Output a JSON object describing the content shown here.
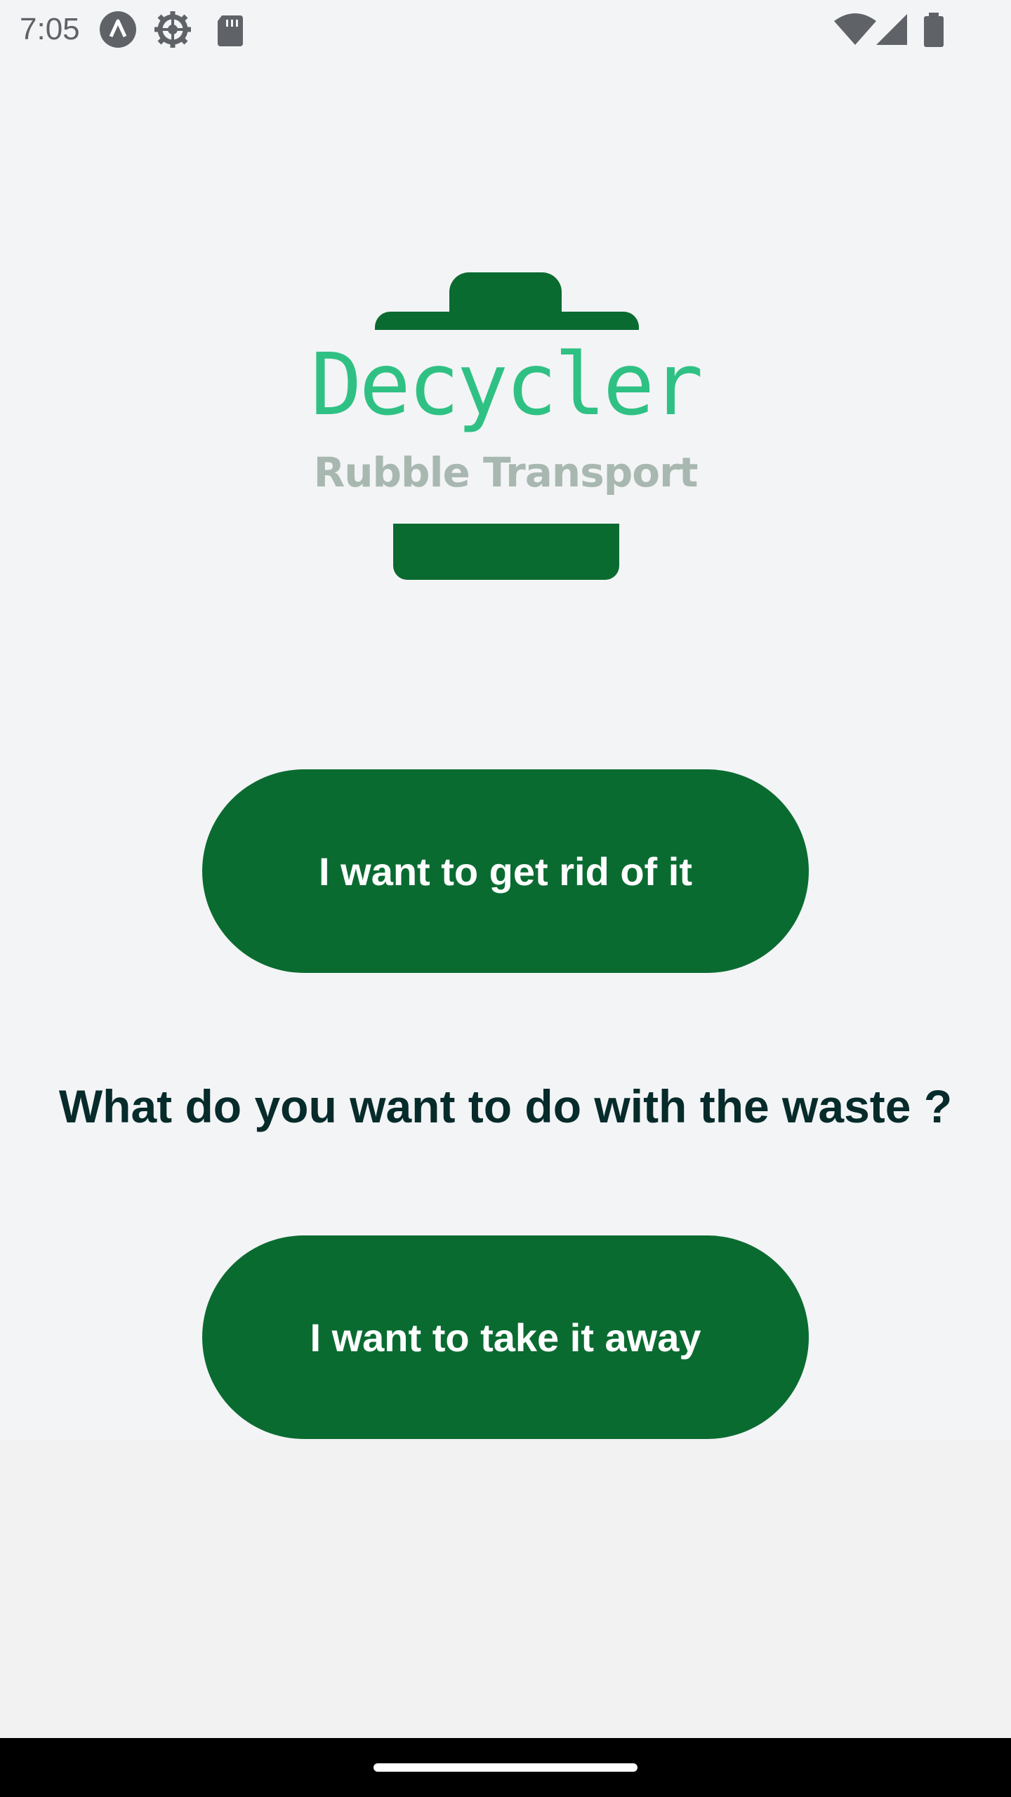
{
  "status_bar": {
    "time": "7:05",
    "icons_left": [
      "app-a-icon",
      "settings-gear-icon",
      "sd-card-icon"
    ],
    "icons_right": [
      "wifi-icon",
      "cellular-signal-icon",
      "battery-icon"
    ]
  },
  "logo": {
    "title": "Decycler",
    "subtitle": "Rubble Transport"
  },
  "main": {
    "button_primary": "I want to get rid of it",
    "question": "What do you want to do with the waste ?",
    "button_secondary": "I want to take it away"
  },
  "colors": {
    "brand_green": "#0a6b31",
    "logo_text_green": "#2fc184",
    "logo_subtitle_gray": "#a8b8b0",
    "question_text": "#062b2a",
    "background": "#f3f4f6"
  }
}
